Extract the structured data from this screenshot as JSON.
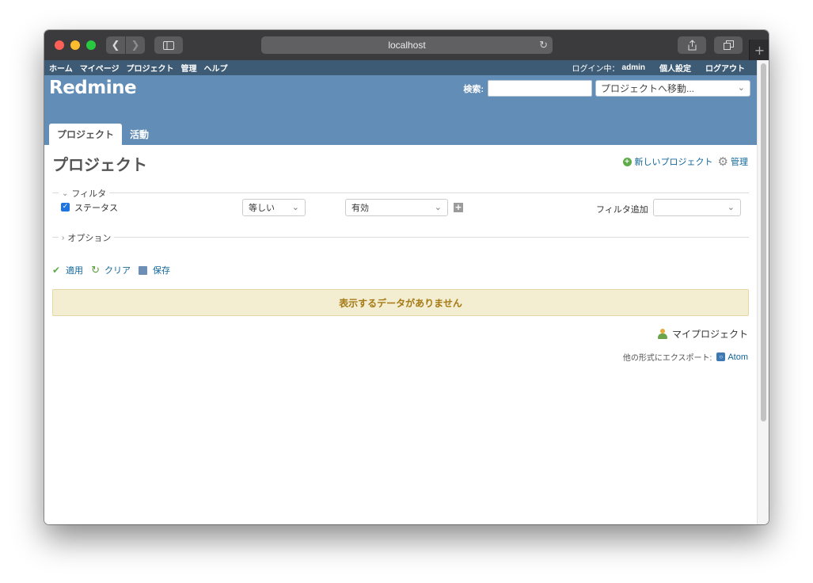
{
  "browser": {
    "url": "localhost",
    "icons": {
      "back": "chevron-left-icon",
      "forward": "chevron-right-icon",
      "sidebar": "sidebar-icon",
      "reload": "reload-icon",
      "share": "share-icon",
      "tabs": "tabs-icon",
      "new_tab": "plus-icon"
    }
  },
  "top_menu": {
    "items": [
      "ホーム",
      "マイページ",
      "プロジェクト",
      "管理",
      "ヘルプ"
    ],
    "logged_in_label": "ログイン中：",
    "user": "admin",
    "my_account": "個人設定",
    "logout": "ログアウト"
  },
  "header": {
    "app_title": "Redmine",
    "search_label": "検索:",
    "search_value": "",
    "jump_to_project": "プロジェクトへ移動..."
  },
  "main_menu": {
    "tabs": [
      {
        "label": "プロジェクト",
        "selected": true
      },
      {
        "label": "活動",
        "selected": false
      }
    ]
  },
  "contextual": {
    "new_project": "新しいプロジェクト",
    "admin": "管理"
  },
  "page": {
    "title": "プロジェクト"
  },
  "filters": {
    "legend": "フィルタ",
    "status_label": "ステータス",
    "status_checked": true,
    "operator": "等しい",
    "value": "有効",
    "add_filter_label": "フィルタ追加",
    "add_filter_value": ""
  },
  "options": {
    "legend": "オプション"
  },
  "buttons": {
    "apply": "適用",
    "clear": "クリア",
    "save": "保存"
  },
  "results": {
    "no_data": "表示するデータがありません"
  },
  "footer": {
    "my_projects": "マイプロジェクト",
    "export_label": "他の形式にエクスポート:",
    "atom": "Atom"
  },
  "colors": {
    "top_menu_bg": "#3e5b76",
    "header_bg": "#628db6",
    "link": "#116699",
    "nodata_bg": "#f3edd1",
    "nodata_text": "#a57a15"
  }
}
